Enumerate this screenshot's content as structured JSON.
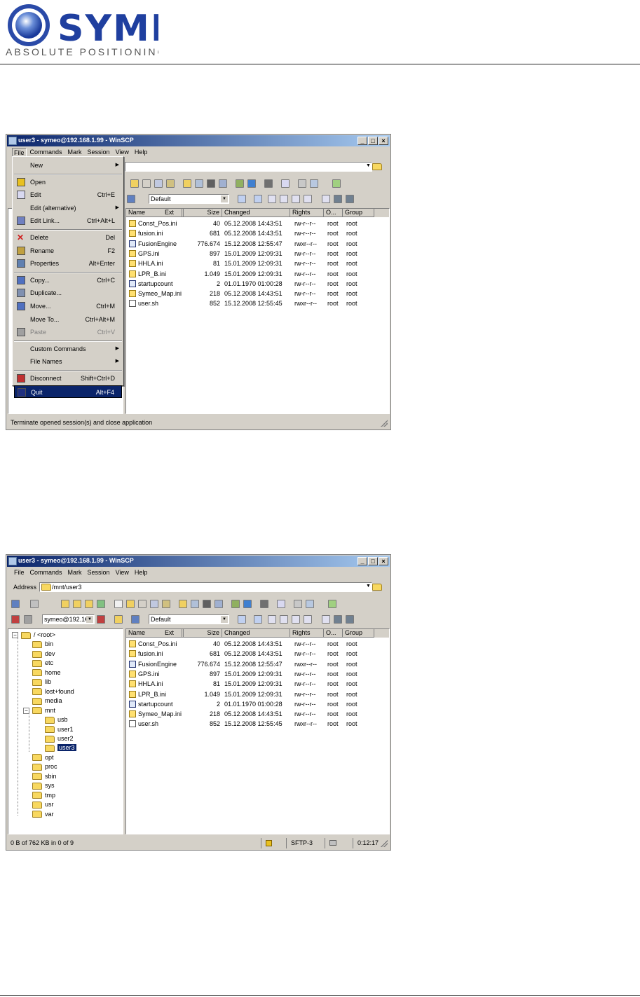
{
  "header": {
    "logo_name": "SYMEO",
    "logo_tagline": "ABSOLUTE POSITIONING"
  },
  "window_title": "user3 - symeo@192.168.1.99 - WinSCP",
  "caption_buttons": {
    "min": "_",
    "max": "□",
    "close": "×"
  },
  "menus": [
    "File",
    "Commands",
    "Mark",
    "Session",
    "View",
    "Help"
  ],
  "address": {
    "label": "Address",
    "path": "/mnt/user3"
  },
  "session_combo": "symeo@192.1€",
  "transfer_preset": "Default",
  "columns": {
    "name": "Name",
    "ext": "Ext",
    "size": "Size",
    "changed": "Changed",
    "rights": "Rights",
    "owner": "O...",
    "group": "Group"
  },
  "files": [
    {
      "name": "Const_Pos.ini",
      "size": "40",
      "changed": "05.12.2008 14:43:51",
      "rights": "rw-r--r--",
      "owner": "root",
      "group": "root",
      "icon": "ini"
    },
    {
      "name": "fusion.ini",
      "size": "681",
      "changed": "05.12.2008 14:43:51",
      "rights": "rw-r--r--",
      "owner": "root",
      "group": "root",
      "icon": "ini"
    },
    {
      "name": "FusionEngine",
      "size": "776.674",
      "changed": "15.12.2008 12:55:47",
      "rights": "rwxr--r--",
      "owner": "root",
      "group": "root",
      "icon": "exe"
    },
    {
      "name": "GPS.ini",
      "size": "897",
      "changed": "15.01.2009 12:09:31",
      "rights": "rw-r--r--",
      "owner": "root",
      "group": "root",
      "icon": "ini"
    },
    {
      "name": "HHLA.ini",
      "size": "81",
      "changed": "15.01.2009 12:09:31",
      "rights": "rw-r--r--",
      "owner": "root",
      "group": "root",
      "icon": "ini"
    },
    {
      "name": "LPR_B.ini",
      "size": "1.049",
      "changed": "15.01.2009 12:09:31",
      "rights": "rw-r--r--",
      "owner": "root",
      "group": "root",
      "icon": "ini"
    },
    {
      "name": "startupcount",
      "size": "2",
      "changed": "01.01.1970 01:00:28",
      "rights": "rw-r--r--",
      "owner": "root",
      "group": "root",
      "icon": "exe"
    },
    {
      "name": "Symeo_Map.ini",
      "size": "218",
      "changed": "05.12.2008 14:43:51",
      "rights": "rw-r--r--",
      "owner": "root",
      "group": "root",
      "icon": "ini"
    },
    {
      "name": "user.sh",
      "size": "852",
      "changed": "15.12.2008 12:55:45",
      "rights": "rwxr--r--",
      "owner": "root",
      "group": "root",
      "icon": "sh"
    }
  ],
  "file_menu": [
    {
      "label": "New",
      "shortcut": "",
      "submenu": true,
      "disabled": false
    },
    {
      "sep": true
    },
    {
      "label": "Open",
      "shortcut": "",
      "submenu": false,
      "disabled": false
    },
    {
      "label": "Edit",
      "shortcut": "Ctrl+E",
      "submenu": false,
      "disabled": false
    },
    {
      "label": "Edit (alternative)",
      "shortcut": "",
      "submenu": true,
      "disabled": false
    },
    {
      "label": "Edit Link...",
      "shortcut": "Ctrl+Alt+L",
      "submenu": false,
      "disabled": false
    },
    {
      "sep": true
    },
    {
      "label": "Delete",
      "shortcut": "Del",
      "submenu": false,
      "disabled": false
    },
    {
      "label": "Rename",
      "shortcut": "F2",
      "submenu": false,
      "disabled": false
    },
    {
      "label": "Properties",
      "shortcut": "Alt+Enter",
      "submenu": false,
      "disabled": false
    },
    {
      "sep": true
    },
    {
      "label": "Copy...",
      "shortcut": "Ctrl+C",
      "submenu": false,
      "disabled": false
    },
    {
      "label": "Duplicate...",
      "shortcut": "",
      "submenu": false,
      "disabled": false
    },
    {
      "label": "Move...",
      "shortcut": "Ctrl+M",
      "submenu": false,
      "disabled": false
    },
    {
      "label": "Move To...",
      "shortcut": "Ctrl+Alt+M",
      "submenu": false,
      "disabled": false
    },
    {
      "label": "Paste",
      "shortcut": "Ctrl+V",
      "submenu": false,
      "disabled": true
    },
    {
      "sep": true
    },
    {
      "label": "Custom Commands",
      "shortcut": "",
      "submenu": true,
      "disabled": false
    },
    {
      "label": "File Names",
      "shortcut": "",
      "submenu": true,
      "disabled": false
    },
    {
      "sep": true
    },
    {
      "label": "Disconnect",
      "shortcut": "Shift+Ctrl+D",
      "submenu": false,
      "disabled": false
    },
    {
      "label": "Quit",
      "shortcut": "Alt+F4",
      "submenu": false,
      "disabled": false,
      "highlighted": true
    }
  ],
  "tree": [
    {
      "label": "/ <root>",
      "level": 0,
      "expander": "−"
    },
    {
      "label": "bin",
      "level": 1
    },
    {
      "label": "dev",
      "level": 1
    },
    {
      "label": "etc",
      "level": 1
    },
    {
      "label": "home",
      "level": 1
    },
    {
      "label": "lib",
      "level": 1
    },
    {
      "label": "lost+found",
      "level": 1
    },
    {
      "label": "media",
      "level": 1
    },
    {
      "label": "mnt",
      "level": 1,
      "expander": "−"
    },
    {
      "label": "usb",
      "level": 2
    },
    {
      "label": "user1",
      "level": 2
    },
    {
      "label": "user2",
      "level": 2
    },
    {
      "label": "user3",
      "level": 2,
      "selected": true
    },
    {
      "label": "opt",
      "level": 1
    },
    {
      "label": "proc",
      "level": 1
    },
    {
      "label": "sbin",
      "level": 1
    },
    {
      "label": "sys",
      "level": 1
    },
    {
      "label": "tmp",
      "level": 1
    },
    {
      "label": "usr",
      "level": 1
    },
    {
      "label": "var",
      "level": 1
    }
  ],
  "win1": {
    "status": "Terminate opened session(s) and close application",
    "tree_visible_label": "var"
  },
  "win2": {
    "status": "0 B of 762 KB in 0 of 9",
    "protocol": "SFTP-3",
    "elapsed": "0:12:17"
  }
}
